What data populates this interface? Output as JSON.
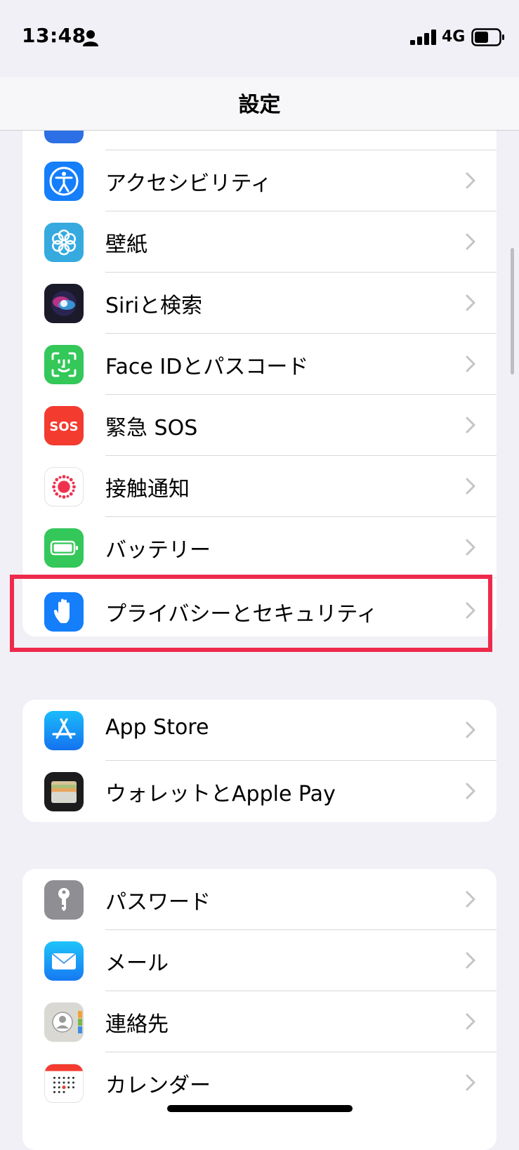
{
  "status": {
    "time": "13:48",
    "network": "4G"
  },
  "nav": {
    "title": "設定"
  },
  "rows": {
    "accessibility": "アクセシビリティ",
    "wallpaper": "壁紙",
    "siri": "Siriと検索",
    "faceid": "Face IDとパスコード",
    "sos": "緊急 SOS",
    "sos_icon_text": "SOS",
    "exposure": "接触通知",
    "battery": "バッテリー",
    "privacy": "プライバシーとセキュリティ",
    "appstore": "App Store",
    "wallet": "ウォレットとApple Pay",
    "passwords": "パスワード",
    "mail": "メール",
    "contacts": "連絡先",
    "calendar": "カレンダー"
  },
  "icons": [
    "display-icon",
    "accessibility-icon",
    "wallpaper-icon",
    "siri-icon",
    "faceid-icon",
    "sos-icon",
    "exposure-notification-icon",
    "battery-icon",
    "privacy-hand-icon",
    "app-store-icon",
    "wallet-icon",
    "key-icon",
    "mail-icon",
    "contacts-icon",
    "calendar-icon",
    "chevron-right-icon"
  ],
  "colors": {
    "background": "#f1f0f6",
    "highlight": "#ee2a4c",
    "blue": "#147efb",
    "green": "#34c759",
    "red": "#f33b30",
    "gray": "#8e8e93",
    "chevron": "#c4c4c7"
  }
}
